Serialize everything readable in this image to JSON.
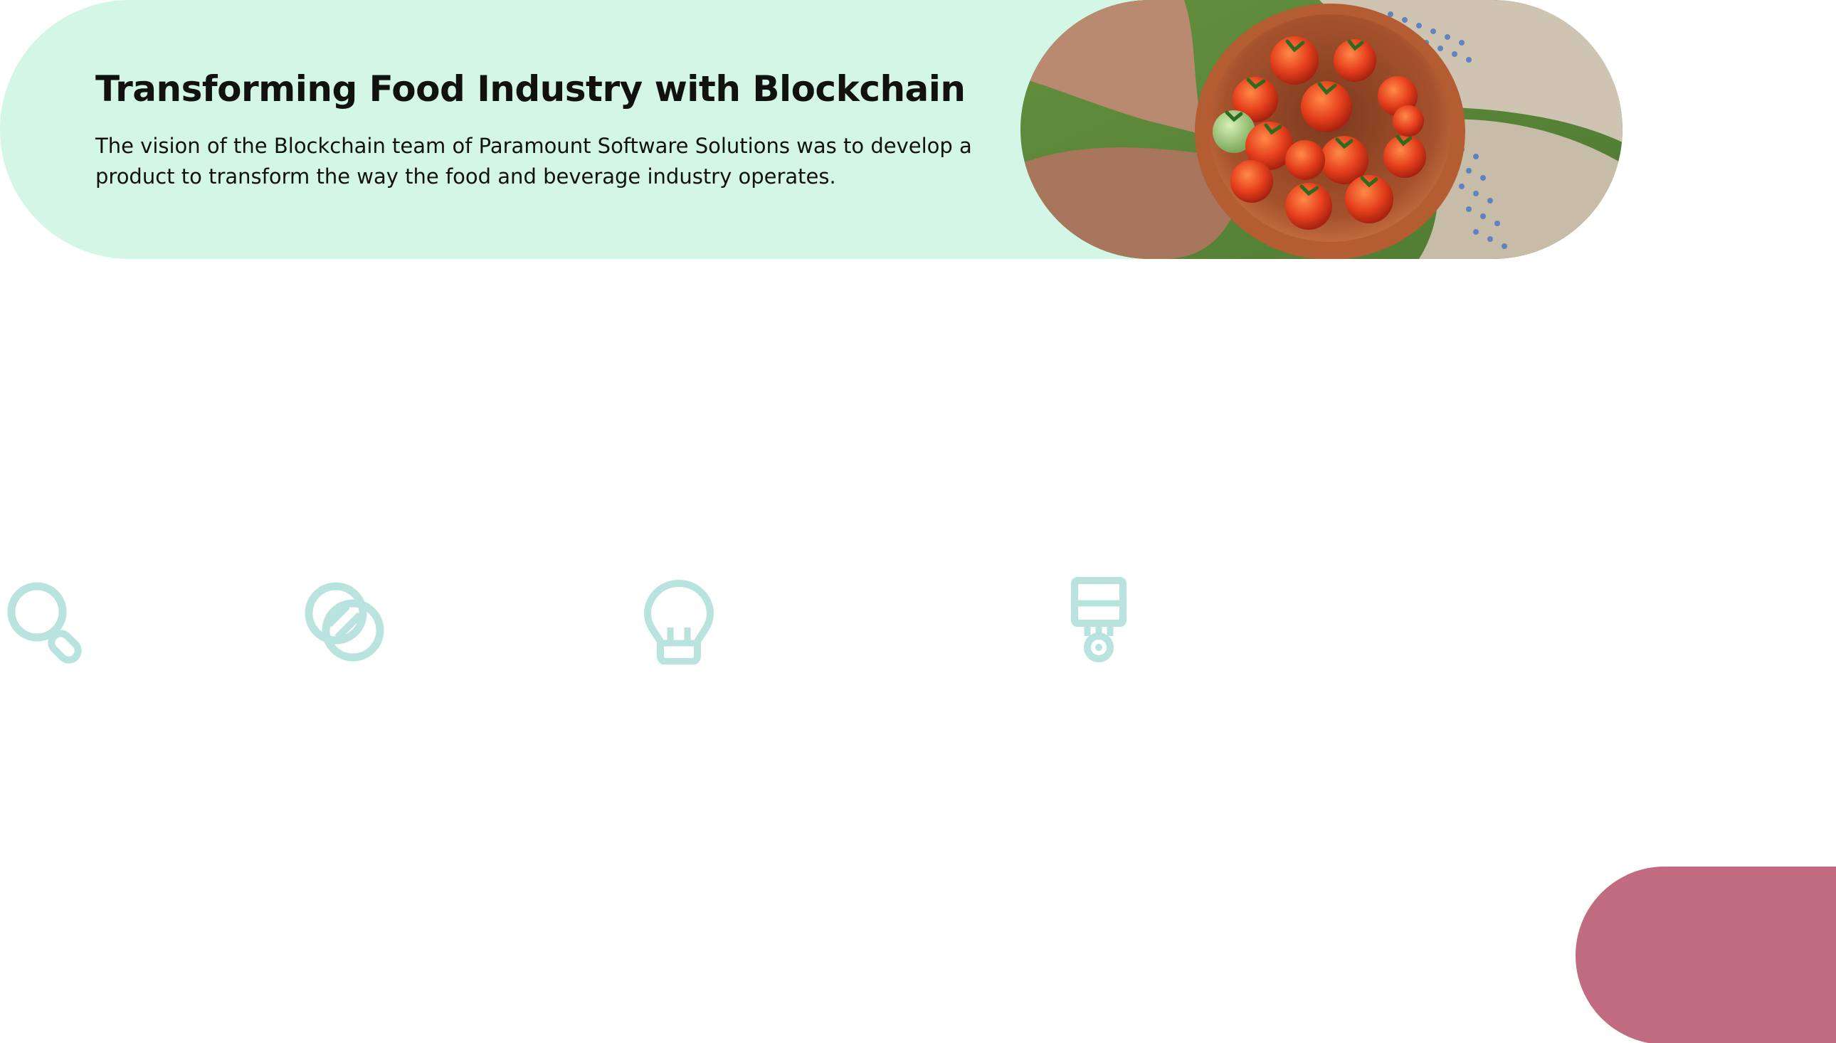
{
  "hero": {
    "title": "Transforming Food Industry with Blockchain",
    "body": "The vision of the Blockchain team of Paramount Software Solutions was to develop a product to transform the way the food and beverage industry operates."
  },
  "colors": {
    "hero_bg": "#d3f6e7",
    "icon_stroke": "#b9e3df",
    "accent_pill": "#c16b80"
  },
  "icons": [
    "magnifier-icon",
    "overlapping-circles-icon",
    "lightbulb-icon",
    "paintbrush-icon"
  ]
}
